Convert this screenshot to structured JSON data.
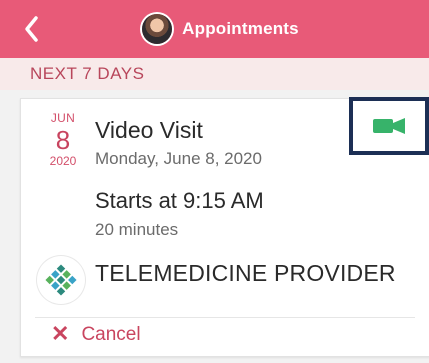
{
  "app_bar": {
    "title": "Appointments",
    "back_icon": "chevron-left-icon",
    "avatar_icon": "user-avatar-icon",
    "color": "#e85a78"
  },
  "section": {
    "title": "NEXT 7 DAYS",
    "bg_color": "#f8eaea",
    "text_color": "#b8465b"
  },
  "appointment": {
    "date": {
      "month": "JUN",
      "day": "8",
      "year": "2020"
    },
    "visit_title": "Video Visit",
    "visit_date": "Monday, June 8, 2020",
    "start_text": "Starts at 9:15 AM",
    "duration": "20 minutes",
    "provider": "TELEMEDICINE PROVIDER",
    "actions": {
      "cancel_label": "Cancel",
      "cancel_icon": "close-icon",
      "video_icon": "video-camera-icon"
    },
    "colors": {
      "accent": "#d34f6a",
      "video": "#37b36a",
      "highlight_border": "#1c2f55"
    }
  }
}
